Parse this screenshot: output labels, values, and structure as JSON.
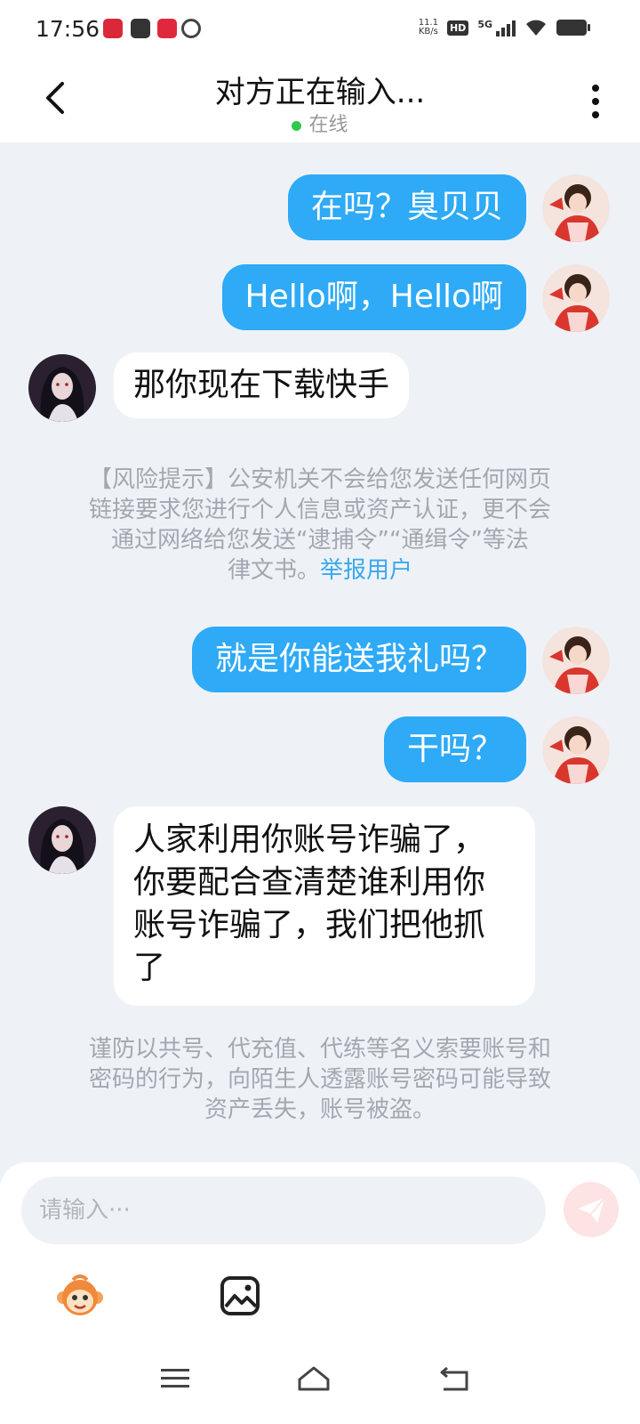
{
  "status": {
    "time": "17:56",
    "net_speed_top": "11.1",
    "net_speed_bottom": "KB/s",
    "hd": "HD",
    "network": "5G"
  },
  "header": {
    "title": "对方正在输入...",
    "status": "在线"
  },
  "messages": [
    {
      "side": "out",
      "text": "在吗？臭贝贝"
    },
    {
      "side": "out",
      "text": "Hello啊，Hello啊"
    },
    {
      "side": "in",
      "text": "那你现在下载快手"
    },
    {
      "side": "out",
      "text": "就是你能送我礼吗？"
    },
    {
      "side": "out",
      "text": "干吗？"
    },
    {
      "side": "in",
      "lines": [
        "人家利用你账号诈骗了，",
        "你要配合查清楚谁利用你",
        "账号诈骗了，我们把他抓",
        "了"
      ]
    }
  ],
  "risk_notice": {
    "lines": [
      "【风险提示】公安机关不会给您发送任何网页",
      "链接要求您进行个人信息或资产认证，更不会",
      "通过网络给您发送“逮捕令”“通缉令”等法"
    ],
    "last_line": "律文书。",
    "link": "举报用户"
  },
  "account_notice": {
    "lines": [
      "谨防以共号、代充值、代练等名义索要账号和",
      "密码的行为，向陌生人透露账号密码可能导致",
      "资产丢失，账号被盗。"
    ]
  },
  "input": {
    "placeholder": "请输入···"
  },
  "icons": {
    "emoji": "monkey-emoji-icon",
    "picture": "picture-icon",
    "send": "send-icon"
  },
  "colors": {
    "outgoing_bubble": "#2eaaf6",
    "incoming_bubble": "#ffffff",
    "background": "#eef2f7",
    "online_dot": "#2ec84c",
    "link": "#3aa8ec"
  }
}
